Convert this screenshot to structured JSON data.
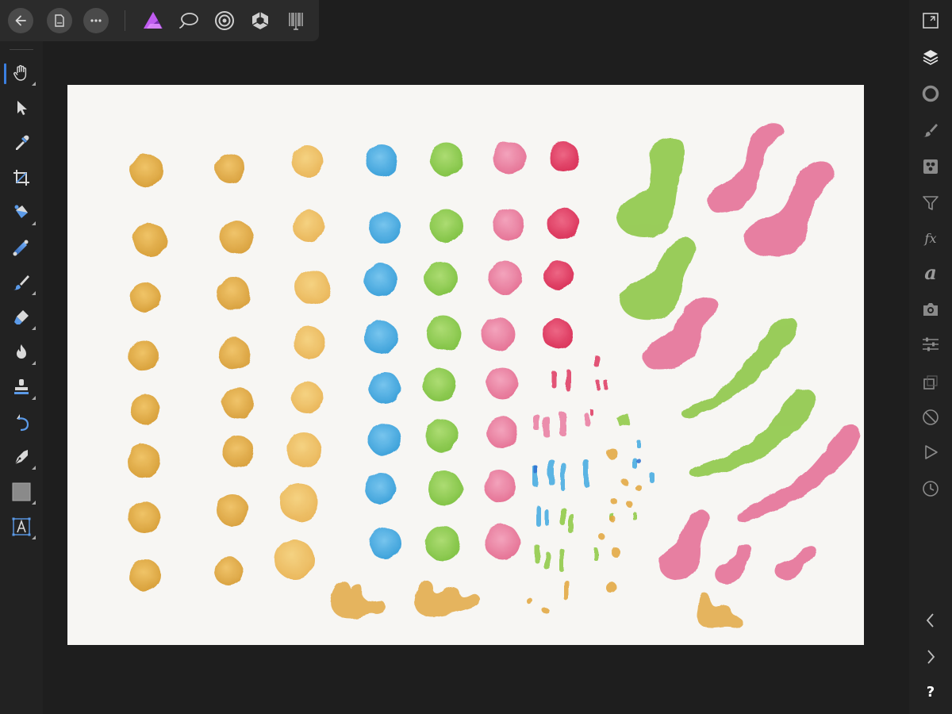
{
  "app": {
    "topbar": {
      "buttons": [
        {
          "name": "back-button",
          "icon": "arrow-left-icon"
        },
        {
          "name": "document-menu-button",
          "icon": "document-icon"
        },
        {
          "name": "more-menu-button",
          "icon": "ellipsis-icon"
        }
      ],
      "personas": [
        {
          "name": "photo-persona-button",
          "icon": "affinity-photo-icon",
          "accent": "#b04cd9"
        },
        {
          "name": "liquify-persona-button",
          "icon": "lasso-icon"
        },
        {
          "name": "develop-persona-button",
          "icon": "aperture-icon"
        },
        {
          "name": "tone-mapping-persona-button",
          "icon": "shutter-icon"
        },
        {
          "name": "export-persona-button",
          "icon": "barcode-icon"
        }
      ]
    },
    "tools": [
      "view-tool",
      "move-tool",
      "color-picker-tool",
      "crop-tool",
      "flood-fill-tool",
      "gradient-tool",
      "paint-brush-tool",
      "eraser-tool",
      "dodge-burn-tool",
      "clone-tool",
      "undo-brush-tool",
      "pen-tool",
      "rectangle-tool",
      "artistic-text-tool"
    ],
    "studio": [
      "navigator-icon",
      "layers-icon",
      "color-icon",
      "brushes-icon",
      "swatches-icon",
      "adjustments-icon",
      "fx-icon",
      "text-styles-icon",
      "stock-icon",
      "channels-icon",
      "transform-icon",
      "history-block-icon",
      "macro-play-icon",
      "history-icon"
    ],
    "studio_labels": {
      "fx": "fx",
      "text": "a"
    },
    "bottom_right": {
      "prev": "chevron-left-icon",
      "next": "chevron-right-icon",
      "help": "?"
    },
    "colors": {
      "accent": "#3b7fe0",
      "ochre": "#e2a53a",
      "blue": "#3fa8e0",
      "green": "#8cc840",
      "pink": "#e8749a",
      "crimson": "#dc2a55"
    }
  }
}
